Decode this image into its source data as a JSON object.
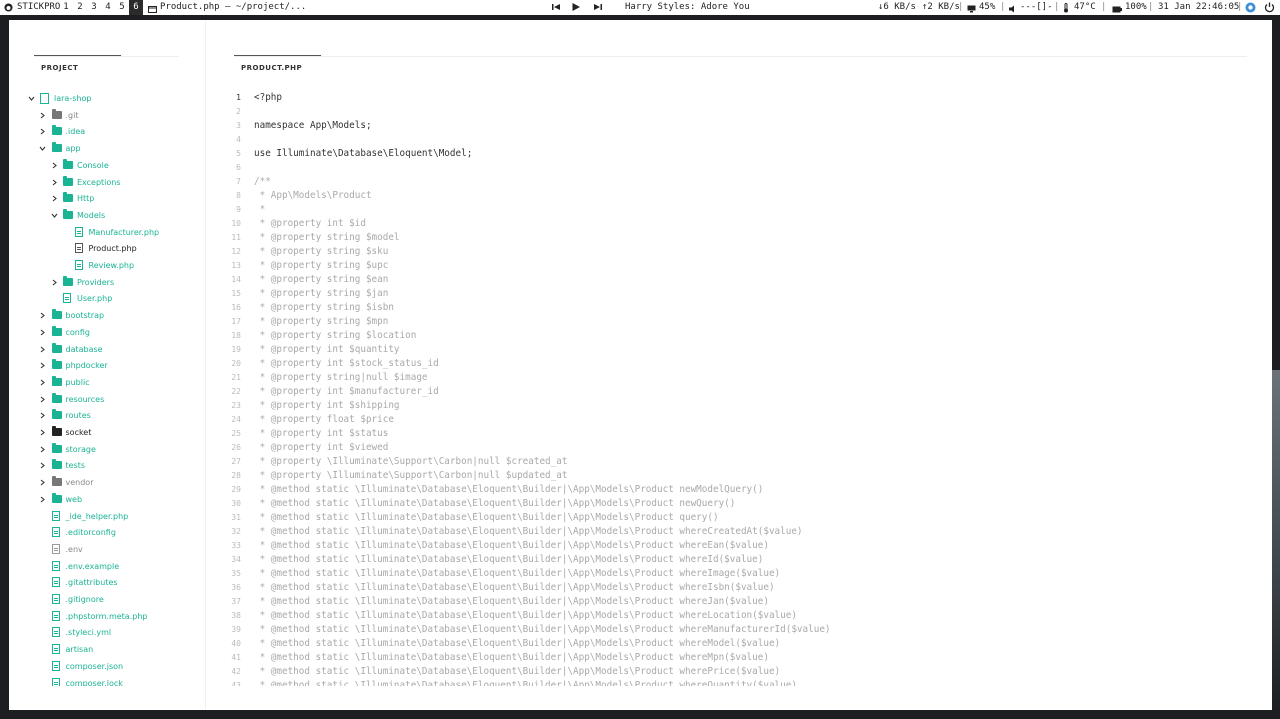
{
  "topbar": {
    "launcher_label": "STICKPRO",
    "workspaces": [
      "1",
      "2",
      "3",
      "4",
      "5",
      "6"
    ],
    "active_window_title": "Product.php — ~/project/...",
    "now_playing": "Harry Styles: Adore You",
    "net_down": "↓6 KB/s",
    "net_up": "↑2 KB/s",
    "cpu": "45%",
    "volume": "---[]-",
    "temperature": "47°C",
    "battery": "100%",
    "datetime": "31 Jan 22:46:05"
  },
  "sidebar": {
    "panel_title": "PROJECT",
    "tree": [
      {
        "label": "lara-shop",
        "type": "repo",
        "depth": 0,
        "chevron": "open",
        "tone": "teal"
      },
      {
        "label": ".git",
        "type": "folder",
        "depth": 1,
        "chevron": "closed",
        "tone": "grey"
      },
      {
        "label": ".idea",
        "type": "folder",
        "depth": 1,
        "chevron": "closed",
        "tone": "teal"
      },
      {
        "label": "app",
        "type": "folder",
        "depth": 1,
        "chevron": "open",
        "tone": "teal"
      },
      {
        "label": "Console",
        "type": "folder",
        "depth": 2,
        "chevron": "closed",
        "tone": "teal"
      },
      {
        "label": "Exceptions",
        "type": "folder",
        "depth": 2,
        "chevron": "closed",
        "tone": "teal"
      },
      {
        "label": "Http",
        "type": "folder",
        "depth": 2,
        "chevron": "closed",
        "tone": "teal"
      },
      {
        "label": "Models",
        "type": "folder",
        "depth": 2,
        "chevron": "open",
        "tone": "teal"
      },
      {
        "label": "Manufacturer.php",
        "type": "file",
        "depth": 3,
        "chevron": "",
        "tone": "teal"
      },
      {
        "label": "Product.php",
        "type": "file",
        "depth": 3,
        "chevron": "",
        "tone": "dark"
      },
      {
        "label": "Review.php",
        "type": "file",
        "depth": 3,
        "chevron": "",
        "tone": "teal"
      },
      {
        "label": "Providers",
        "type": "folder",
        "depth": 2,
        "chevron": "closed",
        "tone": "teal"
      },
      {
        "label": "User.php",
        "type": "file",
        "depth": 2,
        "chevron": "",
        "tone": "teal"
      },
      {
        "label": "bootstrap",
        "type": "folder",
        "depth": 1,
        "chevron": "closed",
        "tone": "teal"
      },
      {
        "label": "config",
        "type": "folder",
        "depth": 1,
        "chevron": "closed",
        "tone": "teal"
      },
      {
        "label": "database",
        "type": "folder",
        "depth": 1,
        "chevron": "closed",
        "tone": "teal"
      },
      {
        "label": "phpdocker",
        "type": "folder",
        "depth": 1,
        "chevron": "closed",
        "tone": "teal"
      },
      {
        "label": "public",
        "type": "folder",
        "depth": 1,
        "chevron": "closed",
        "tone": "teal"
      },
      {
        "label": "resources",
        "type": "folder",
        "depth": 1,
        "chevron": "closed",
        "tone": "teal"
      },
      {
        "label": "routes",
        "type": "folder",
        "depth": 1,
        "chevron": "closed",
        "tone": "teal"
      },
      {
        "label": "socket",
        "type": "folder",
        "depth": 1,
        "chevron": "closed",
        "tone": "black"
      },
      {
        "label": "storage",
        "type": "folder",
        "depth": 1,
        "chevron": "closed",
        "tone": "teal"
      },
      {
        "label": "tests",
        "type": "folder",
        "depth": 1,
        "chevron": "closed",
        "tone": "teal"
      },
      {
        "label": "vendor",
        "type": "folder",
        "depth": 1,
        "chevron": "closed",
        "tone": "grey"
      },
      {
        "label": "web",
        "type": "folder",
        "depth": 1,
        "chevron": "closed",
        "tone": "teal"
      },
      {
        "label": "_ide_helper.php",
        "type": "file",
        "depth": 1,
        "chevron": "",
        "tone": "teal"
      },
      {
        "label": ".editorconfig",
        "type": "file",
        "depth": 1,
        "chevron": "",
        "tone": "teal"
      },
      {
        "label": ".env",
        "type": "file",
        "depth": 1,
        "chevron": "",
        "tone": "grey"
      },
      {
        "label": ".env.example",
        "type": "file",
        "depth": 1,
        "chevron": "",
        "tone": "teal"
      },
      {
        "label": ".gitattributes",
        "type": "file",
        "depth": 1,
        "chevron": "",
        "tone": "teal"
      },
      {
        "label": ".gitignore",
        "type": "file",
        "depth": 1,
        "chevron": "",
        "tone": "teal"
      },
      {
        "label": ".phpstorm.meta.php",
        "type": "file",
        "depth": 1,
        "chevron": "",
        "tone": "teal"
      },
      {
        "label": ".styleci.yml",
        "type": "file",
        "depth": 1,
        "chevron": "",
        "tone": "teal"
      },
      {
        "label": "artisan",
        "type": "file",
        "depth": 1,
        "chevron": "",
        "tone": "teal"
      },
      {
        "label": "composer.json",
        "type": "file",
        "depth": 1,
        "chevron": "",
        "tone": "teal"
      },
      {
        "label": "composer.lock",
        "type": "file",
        "depth": 1,
        "chevron": "",
        "tone": "teal"
      }
    ]
  },
  "editor": {
    "tab_title": "PRODUCT.PHP",
    "current_line": 1,
    "lines": [
      {
        "n": "1",
        "text": "<?php",
        "kind": "code"
      },
      {
        "n": "2",
        "text": "",
        "kind": "code"
      },
      {
        "n": "3",
        "text": "namespace App\\Models;",
        "kind": "code"
      },
      {
        "n": "4",
        "text": "",
        "kind": "code"
      },
      {
        "n": "5",
        "text": "use Illuminate\\Database\\Eloquent\\Model;",
        "kind": "code"
      },
      {
        "n": "6",
        "text": "",
        "kind": "code"
      },
      {
        "n": "7",
        "text": "/**",
        "kind": "comment"
      },
      {
        "n": "8",
        "text": " * App\\Models\\Product",
        "kind": "comment"
      },
      {
        "n": "9",
        "text": " *",
        "kind": "comment"
      },
      {
        "n": "10",
        "text": " * @property int $id",
        "kind": "comment"
      },
      {
        "n": "11",
        "text": " * @property string $model",
        "kind": "comment"
      },
      {
        "n": "12",
        "text": " * @property string $sku",
        "kind": "comment"
      },
      {
        "n": "13",
        "text": " * @property string $upc",
        "kind": "comment"
      },
      {
        "n": "14",
        "text": " * @property string $ean",
        "kind": "comment"
      },
      {
        "n": "15",
        "text": " * @property string $jan",
        "kind": "comment"
      },
      {
        "n": "16",
        "text": " * @property string $isbn",
        "kind": "comment"
      },
      {
        "n": "17",
        "text": " * @property string $mpn",
        "kind": "comment"
      },
      {
        "n": "18",
        "text": " * @property string $location",
        "kind": "comment"
      },
      {
        "n": "19",
        "text": " * @property int $quantity",
        "kind": "comment"
      },
      {
        "n": "20",
        "text": " * @property int $stock_status_id",
        "kind": "comment"
      },
      {
        "n": "21",
        "text": " * @property string|null $image",
        "kind": "comment"
      },
      {
        "n": "22",
        "text": " * @property int $manufacturer_id",
        "kind": "comment"
      },
      {
        "n": "23",
        "text": " * @property int $shipping",
        "kind": "comment"
      },
      {
        "n": "24",
        "text": " * @property float $price",
        "kind": "comment"
      },
      {
        "n": "25",
        "text": " * @property int $status",
        "kind": "comment"
      },
      {
        "n": "26",
        "text": " * @property int $viewed",
        "kind": "comment"
      },
      {
        "n": "27",
        "text": " * @property \\Illuminate\\Support\\Carbon|null $created_at",
        "kind": "comment"
      },
      {
        "n": "28",
        "text": " * @property \\Illuminate\\Support\\Carbon|null $updated_at",
        "kind": "comment"
      },
      {
        "n": "29",
        "text": " * @method static \\Illuminate\\Database\\Eloquent\\Builder|\\App\\Models\\Product newModelQuery()",
        "kind": "comment"
      },
      {
        "n": "30",
        "text": " * @method static \\Illuminate\\Database\\Eloquent\\Builder|\\App\\Models\\Product newQuery()",
        "kind": "comment"
      },
      {
        "n": "31",
        "text": " * @method static \\Illuminate\\Database\\Eloquent\\Builder|\\App\\Models\\Product query()",
        "kind": "comment"
      },
      {
        "n": "32",
        "text": " * @method static \\Illuminate\\Database\\Eloquent\\Builder|\\App\\Models\\Product whereCreatedAt($value)",
        "kind": "comment"
      },
      {
        "n": "33",
        "text": " * @method static \\Illuminate\\Database\\Eloquent\\Builder|\\App\\Models\\Product whereEan($value)",
        "kind": "comment"
      },
      {
        "n": "34",
        "text": " * @method static \\Illuminate\\Database\\Eloquent\\Builder|\\App\\Models\\Product whereId($value)",
        "kind": "comment"
      },
      {
        "n": "35",
        "text": " * @method static \\Illuminate\\Database\\Eloquent\\Builder|\\App\\Models\\Product whereImage($value)",
        "kind": "comment"
      },
      {
        "n": "36",
        "text": " * @method static \\Illuminate\\Database\\Eloquent\\Builder|\\App\\Models\\Product whereIsbn($value)",
        "kind": "comment"
      },
      {
        "n": "37",
        "text": " * @method static \\Illuminate\\Database\\Eloquent\\Builder|\\App\\Models\\Product whereJan($value)",
        "kind": "comment"
      },
      {
        "n": "38",
        "text": " * @method static \\Illuminate\\Database\\Eloquent\\Builder|\\App\\Models\\Product whereLocation($value)",
        "kind": "comment"
      },
      {
        "n": "39",
        "text": " * @method static \\Illuminate\\Database\\Eloquent\\Builder|\\App\\Models\\Product whereManufacturerId($value)",
        "kind": "comment"
      },
      {
        "n": "40",
        "text": " * @method static \\Illuminate\\Database\\Eloquent\\Builder|\\App\\Models\\Product whereModel($value)",
        "kind": "comment"
      },
      {
        "n": "41",
        "text": " * @method static \\Illuminate\\Database\\Eloquent\\Builder|\\App\\Models\\Product whereMpn($value)",
        "kind": "comment"
      },
      {
        "n": "42",
        "text": " * @method static \\Illuminate\\Database\\Eloquent\\Builder|\\App\\Models\\Product wherePrice($value)",
        "kind": "comment"
      },
      {
        "n": "43",
        "text": " * @method static \\Illuminate\\Database\\Eloquent\\Builder|\\App\\Models\\Product whereQuantity($value)",
        "kind": "comment"
      }
    ]
  },
  "colors": {
    "accent": "#1ab394",
    "comment": "#a9a9a9",
    "code": "#333333",
    "topbar_bg": "#ffffff",
    "desktop_bg": "#1c1e22"
  },
  "icons": {
    "launcher": "github-icon",
    "window": "window-icon",
    "prev": "previous-track-icon",
    "play": "play-icon",
    "next": "next-track-icon",
    "display": "monitor-icon",
    "volume": "speaker-icon",
    "temperature": "thermometer-icon",
    "battery": "battery-icon",
    "tray": "browser-icon",
    "power": "power-icon"
  }
}
